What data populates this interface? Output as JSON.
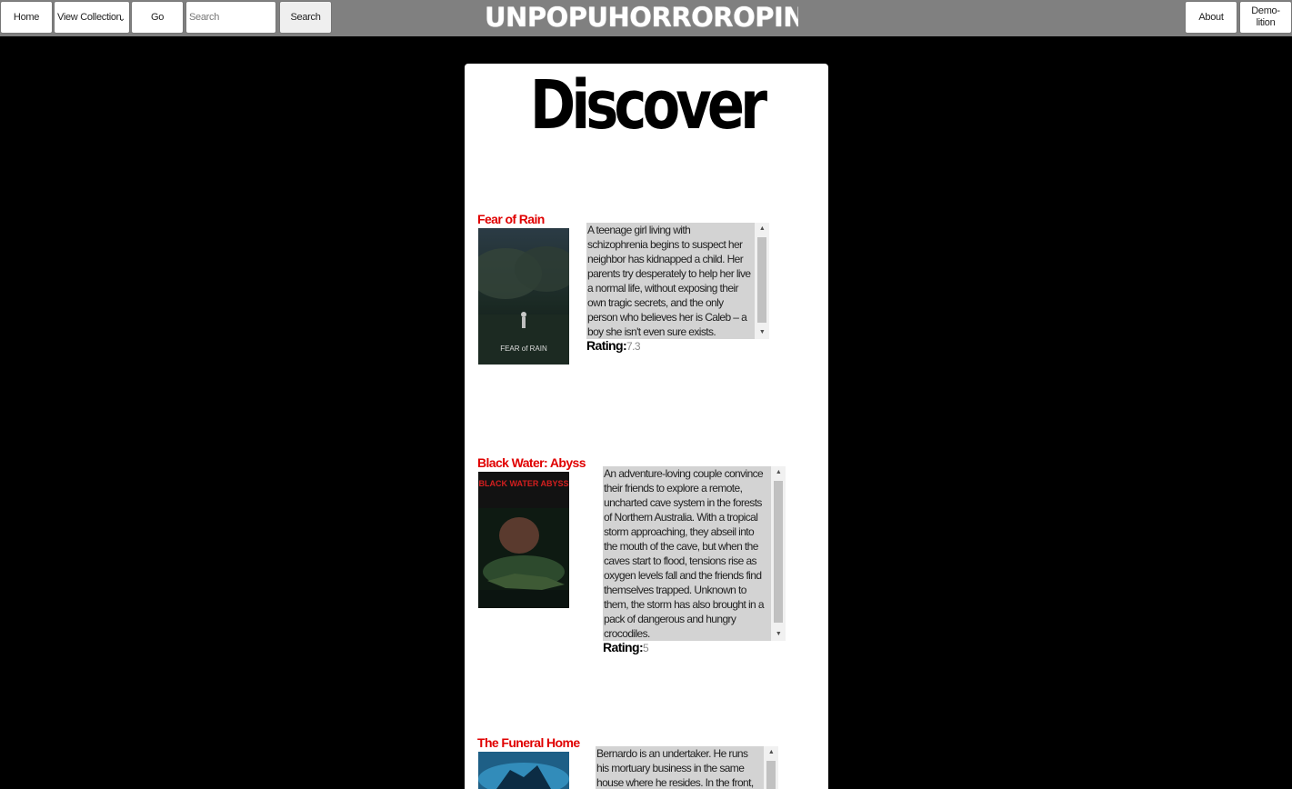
{
  "nav": {
    "home_label": "Home",
    "collection_select": "View Collection",
    "go_label": "Go",
    "search_placeholder": "Search",
    "search_button": "Search",
    "brand": "UNPOPUHORROROPINION",
    "about_label": "About",
    "demolition_label": "Demo-lition"
  },
  "page": {
    "title": "Discover"
  },
  "movies": [
    {
      "title": "Fear of Rain",
      "description": "A teenage girl living with schizophrenia begins to suspect her neighbor has kidnapped a child. Her parents try desperately to help her live a normal life, without exposing their own tragic secrets, and the only person who believes her is Caleb – a boy she isn't even sure exists.",
      "rating_label": "Rating:",
      "rating": "7.3",
      "poster_caption": "FEAR of RAIN"
    },
    {
      "title": "Black Water: Abyss",
      "description": "An adventure-loving couple convince their friends to explore a remote, uncharted cave system in the forests of Northern Australia. With a tropical storm approaching, they abseil into the mouth of the cave, but when the caves start to flood, tensions rise as oxygen levels fall and the friends find themselves trapped. Unknown to them, the storm has also brought in a pack of dangerous and hungry crocodiles.",
      "rating_label": "Rating:",
      "rating": "5",
      "poster_caption": "BLACK WATER ABYSS"
    },
    {
      "title": "The Funeral Home",
      "description": "Bernardo is an undertaker. He runs his mortuary business in the same house where he resides. In the front, he has"
    }
  ],
  "colors": {
    "topbar": "#808080",
    "background": "#000000",
    "card": "#ffffff",
    "movie_title": "#e00000",
    "desc_bg": "#d3d3d3"
  }
}
